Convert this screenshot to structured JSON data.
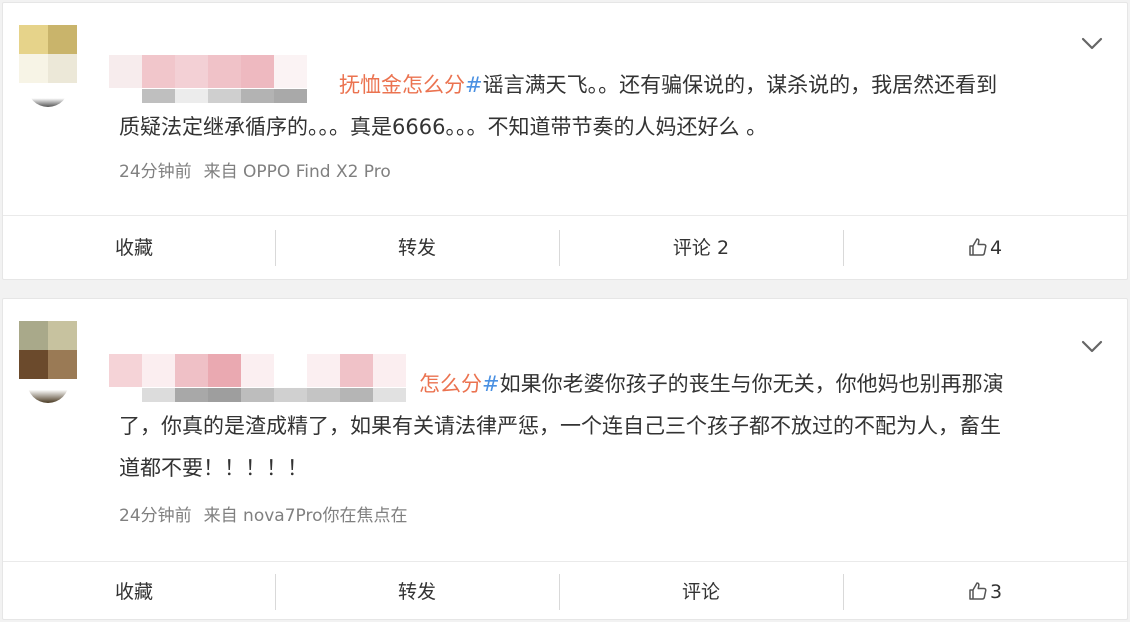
{
  "posts": [
    {
      "topic_text": "抚恤金怎么分",
      "hash": "#",
      "text_line1": "谣言满天飞。。还有骗保说的，谋杀说的，我居然还看到",
      "text_line2": "质疑法定继承循序的。。。真是6666。。。不知道带节奏的人妈还好么 。",
      "time": "24分钟前",
      "source": "来自 OPPO Find X2 Pro",
      "actions": {
        "favorite": "收藏",
        "repost": "转发",
        "comment": "评论 2",
        "like_count": "4"
      }
    },
    {
      "topic_text": "怎么分",
      "hash": "#",
      "text_line1": "如果你老婆你孩子的丧生与你无关，你他妈也别再那演",
      "text_line2": "了，你真的是渣成精了，如果有关请法律严惩，一个连自己三个孩子都不放过的不配为人，畜生",
      "text_line3": "道都不要！！！！！",
      "time": "24分钟前",
      "source": "来自 nova7Pro你在焦点在",
      "actions": {
        "favorite": "收藏",
        "repost": "转发",
        "comment": "评论",
        "like_count": "3"
      }
    }
  ],
  "colors": {
    "topic": "#eb7350",
    "hash": "#4a90e2",
    "meta": "#808080",
    "background": "#f2f2f2"
  },
  "icons": {
    "expand": "chevron-down-icon",
    "like": "thumbs-up-icon"
  }
}
